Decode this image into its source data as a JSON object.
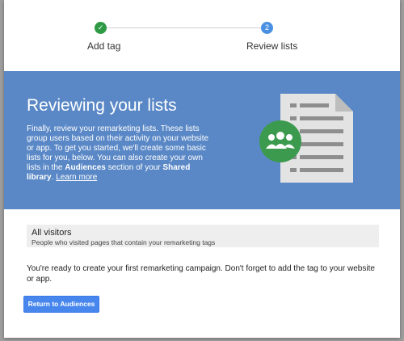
{
  "stepper": {
    "steps": [
      {
        "label": "Add tag",
        "state": "completed",
        "marker": "✓"
      },
      {
        "label": "Review lists",
        "state": "active",
        "marker": "2"
      }
    ]
  },
  "banner": {
    "title": "Reviewing your lists",
    "description_part1": "Finally, review your remarketing lists. These lists group users based on their activity on your website or app. To get you started, we'll create some basic lists for you, below. You can also create your own lists in the ",
    "audiences": "Audiences",
    "description_part2": " section of your ",
    "shared_library": "Shared library",
    "description_part3": ". ",
    "learn_more": "Learn more",
    "illustration_icon": "audience-document-icon"
  },
  "list": {
    "name": "All visitors",
    "description": "People who visited pages that contain your remarketing tags"
  },
  "ready_text": "You're ready to create your first remarketing campaign. Don't forget to add the tag to your website or app.",
  "actions": {
    "return_label": "Return to Audiences"
  },
  "colors": {
    "banner_bg": "#5a88c6",
    "completed_step": "#2e9a44",
    "active_step": "#4a90e2",
    "button_bg": "#4787ed",
    "audience_circle": "#3c9a4f"
  }
}
